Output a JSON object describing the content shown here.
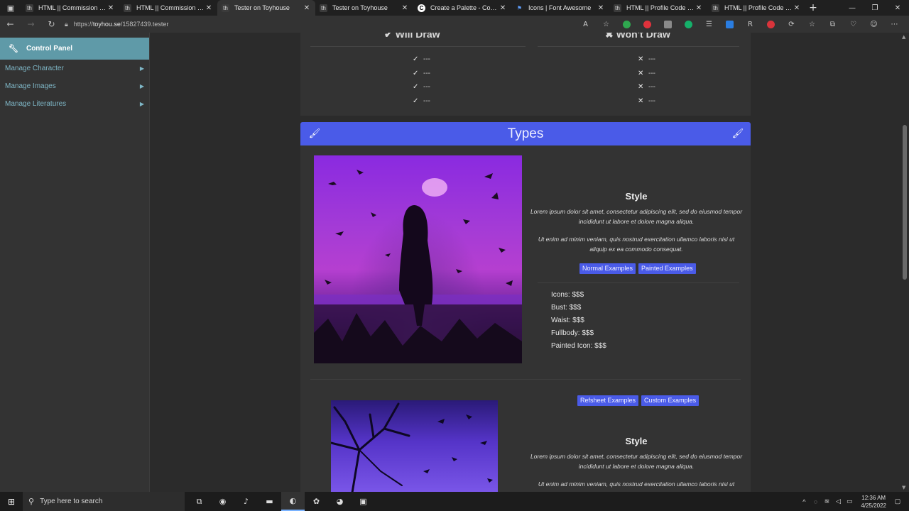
{
  "browser": {
    "tabs": [
      {
        "label": "HTML || Commission Code",
        "favicon": "toyhouse-icon"
      },
      {
        "label": "HTML || Commission Code",
        "favicon": "toyhouse-icon"
      },
      {
        "label": "Tester on Toyhouse",
        "favicon": "toyhouse-icon",
        "active": true
      },
      {
        "label": "Tester on Toyhouse",
        "favicon": "toyhouse-icon"
      },
      {
        "label": "Create a Palette - Coolors",
        "favicon": "coolors-icon"
      },
      {
        "label": "Icons | Font Awesome",
        "favicon": "font-awesome-icon"
      },
      {
        "label": "HTML || Profile Code on To",
        "favicon": "toyhouse-icon"
      },
      {
        "label": "HTML || Profile Code - Pas",
        "favicon": "toyhouse-icon"
      }
    ],
    "url_prefix": "https://",
    "url_host": "toyhou.se",
    "url_path": "/15827439.tester"
  },
  "sidebar": {
    "header": "Control Panel",
    "items": [
      {
        "label": "Manage Character"
      },
      {
        "label": "Manage Images"
      },
      {
        "label": "Manage Literatures"
      }
    ]
  },
  "draw": {
    "will_title": "Will Draw",
    "wont_title": "Won't Draw",
    "will_items": [
      "---",
      "---",
      "---",
      "---"
    ],
    "wont_items": [
      "---",
      "---",
      "---",
      "---"
    ]
  },
  "types": {
    "title": "Types",
    "accent": "#4a5be8",
    "entries": [
      {
        "style_title": "Style",
        "para1": "Lorem ipsum dolor sit amet, consectetur adipiscing elit, sed do eiusmod tempor incididunt ut labore et dolore magna aliqua.",
        "para2": "Ut enim ad minim veniam, quis nostrud exercitation ullamco laboris nisi ut aliquip ex ea commodo consequat.",
        "buttons": [
          "Normal Examples",
          "Painted Examples"
        ],
        "prices": [
          "Icons: $$$",
          "Bust: $$$",
          "Waist: $$$",
          "Fullbody: $$$",
          "Painted Icon: $$$"
        ]
      },
      {
        "style_title": "Style",
        "para1": "Lorem ipsum dolor sit amet, consectetur adipiscing elit, sed do eiusmod tempor incididunt ut labore et dolore magna aliqua.",
        "para2": "Ut enim ad minim veniam, quis nostrud exercitation ullamco laboris nisi ut aliquip ex ea commodo consequat.",
        "buttons": [
          "Refsheet Examples",
          "Custom Examples"
        ]
      }
    ]
  },
  "taskbar": {
    "search_placeholder": "Type here to search",
    "time": "12:36 AM",
    "date": "4/25/2022"
  }
}
